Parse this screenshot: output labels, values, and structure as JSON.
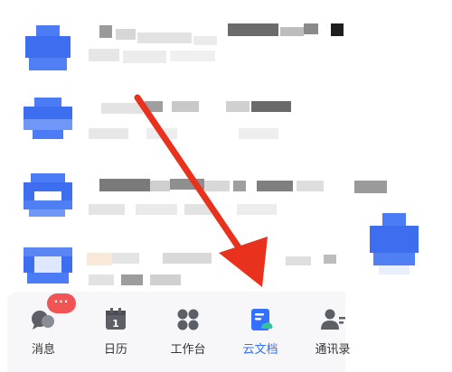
{
  "colors": {
    "accent": "#3370ff",
    "badge": "#f05454",
    "arrow": "#e8321e"
  },
  "tabbar": {
    "tabs": [
      {
        "label": "消息",
        "icon": "chat-bubble-icon",
        "badge": "···"
      },
      {
        "label": "日历",
        "icon": "calendar-icon",
        "calendar_day": "1"
      },
      {
        "label": "工作台",
        "icon": "app-grid-icon"
      },
      {
        "label": "云文档",
        "icon": "cloud-doc-icon",
        "active": true
      },
      {
        "label": "通讯录",
        "icon": "contacts-icon"
      }
    ]
  }
}
